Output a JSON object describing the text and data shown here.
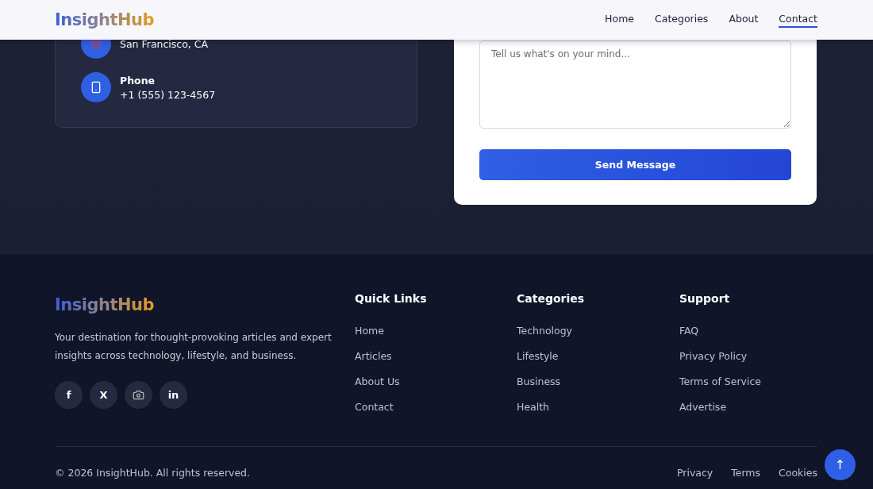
{
  "header": {
    "logo": "InsightHub",
    "nav": [
      {
        "label": "Home",
        "selected": false
      },
      {
        "label": "Categories",
        "selected": false
      },
      {
        "label": "About",
        "selected": false
      },
      {
        "label": "Contact",
        "selected": true
      }
    ]
  },
  "contact_info": [
    {
      "kind": "location",
      "value": "San Francisco, CA"
    },
    {
      "kind": "phone",
      "label": "Phone",
      "value": "+1 (555) 123-4567"
    }
  ],
  "form": {
    "message": {
      "placeholder": "Tell us what's on your mind..."
    },
    "submit": "Send Message"
  },
  "footer": {
    "logo": "InsightHub",
    "tagline": "Your destination for thought-provoking articles and expert insights across technology, lifestyle, and business.",
    "social": [
      {
        "kind": "text",
        "label": "f"
      },
      {
        "kind": "text",
        "label": "X"
      },
      {
        "kind": "camera"
      },
      {
        "kind": "text",
        "label": "in"
      }
    ],
    "columns": [
      {
        "title": "Quick Links",
        "links": [
          "Home",
          "Articles",
          "About Us",
          "Contact"
        ]
      },
      {
        "title": "Categories",
        "links": [
          "Technology",
          "Lifestyle",
          "Business",
          "Health"
        ]
      },
      {
        "title": "Support",
        "links": [
          "FAQ",
          "Privacy Policy",
          "Terms of Service",
          "Advertise"
        ]
      }
    ],
    "copyright": "© 2026 InsightHub. All rights reserved.",
    "legal": [
      "Privacy",
      "Terms",
      "Cookies"
    ],
    "back_to_top": "↑"
  }
}
